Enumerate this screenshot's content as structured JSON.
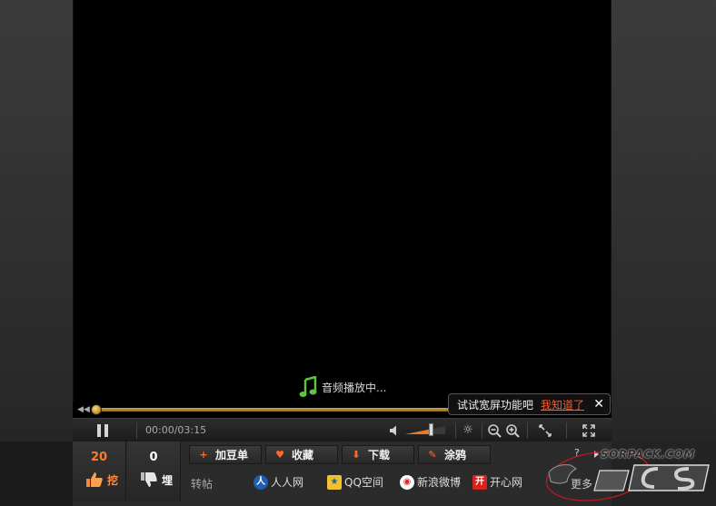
{
  "player": {
    "audio_status": "音频播放中...",
    "time": "00:00/03:15",
    "progress_fraction": 0.02,
    "volume_fraction": 0.6
  },
  "tip": {
    "text": "试试宽屏功能吧",
    "link": "我知道了",
    "close": "✕"
  },
  "vote": {
    "dig_count": "20",
    "dig_label": "挖",
    "bury_count": "0",
    "bury_label": "埋"
  },
  "actions": {
    "add_playlist": "加豆单",
    "favorite": "收藏",
    "download": "下载",
    "doodle": "涂鸦"
  },
  "share": {
    "label": "转帖",
    "renren": "人人网",
    "qzone": "QQ空间",
    "weibo": "新浪微博",
    "kaixin": "开心网",
    "more": "更多",
    "help": "?"
  },
  "watermark": {
    "url": "SORPACK.COM"
  },
  "colors": {
    "accent": "#ff6a2a",
    "progress": "#c9a24a",
    "tip_link": "#ff5a2a"
  }
}
